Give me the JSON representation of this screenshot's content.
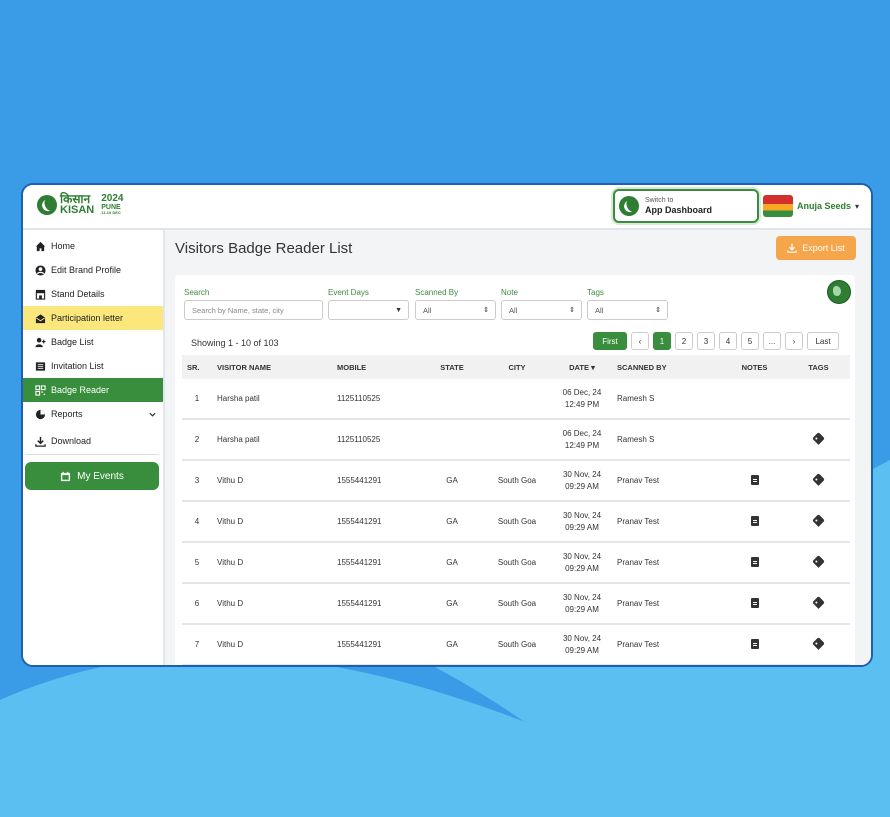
{
  "brand": {
    "logo_line1": "किसान",
    "logo_line2": "KISAN",
    "year": "2024",
    "city": "PUNE",
    "dates": "11-15 DEC"
  },
  "header": {
    "switch_small": "Switch to",
    "switch_main": "App Dashboard",
    "user_name": "Anuja Seeds",
    "user_caret": "▾"
  },
  "sidebar": {
    "items": [
      {
        "label": "Home",
        "icon": "home-icon"
      },
      {
        "label": "Edit Brand Profile",
        "icon": "user-circle-icon"
      },
      {
        "label": "Stand Details",
        "icon": "store-icon"
      },
      {
        "label": "Participation letter",
        "icon": "envelope-open-icon"
      },
      {
        "label": "Badge List",
        "icon": "user-plus-icon"
      },
      {
        "label": "Invitation List",
        "icon": "list-icon"
      },
      {
        "label": "Badge Reader",
        "icon": "qrcode-icon"
      },
      {
        "label": "Reports",
        "icon": "reports-icon"
      },
      {
        "label": "Download",
        "icon": "download-icon"
      }
    ],
    "my_events": "My Events"
  },
  "main": {
    "title": "Visitors Badge Reader List",
    "export_label": "Export List",
    "filters": {
      "search_label": "Search",
      "search_placeholder": "Search by Name, state, city",
      "event_days_label": "Event Days",
      "event_days_value": "",
      "scanned_by_label": "Scanned By",
      "scanned_by_value": "All",
      "note_label": "Note",
      "note_value": "All",
      "tags_label": "Tags",
      "tags_value": "All"
    },
    "showing": "Showing 1 - 10 of 103",
    "pager": {
      "first": "First",
      "prev": "‹",
      "pages": [
        "1",
        "2",
        "3",
        "4",
        "5"
      ],
      "ellipsis": "...",
      "next": "›",
      "last": "Last",
      "current": "1"
    },
    "columns": [
      "SR.",
      "VISITOR NAME",
      "MOBILE",
      "STATE",
      "CITY",
      "DATE ▾",
      "SCANNED BY",
      "NOTES",
      "TAGS"
    ],
    "rows": [
      {
        "sr": "1",
        "name": "Harsha patil",
        "mobile": "1125110525",
        "state": "",
        "city": "",
        "date": "06 Dec, 24",
        "time": "12:49 PM",
        "scanned_by": "Ramesh S",
        "notes": false,
        "tags": false
      },
      {
        "sr": "2",
        "name": "Harsha patil",
        "mobile": "1125110525",
        "state": "",
        "city": "",
        "date": "06 Dec, 24",
        "time": "12:49 PM",
        "scanned_by": "Ramesh S",
        "notes": false,
        "tags": true
      },
      {
        "sr": "3",
        "name": "Vithu D",
        "mobile": "1555441291",
        "state": "GA",
        "city": "South Goa",
        "date": "30 Nov, 24",
        "time": "09:29 AM",
        "scanned_by": "Pranav Test",
        "notes": true,
        "tags": true
      },
      {
        "sr": "4",
        "name": "Vithu D",
        "mobile": "1555441291",
        "state": "GA",
        "city": "South Goa",
        "date": "30 Nov, 24",
        "time": "09:29 AM",
        "scanned_by": "Pranav Test",
        "notes": true,
        "tags": true
      },
      {
        "sr": "5",
        "name": "Vithu D",
        "mobile": "1555441291",
        "state": "GA",
        "city": "South Goa",
        "date": "30 Nov, 24",
        "time": "09:29 AM",
        "scanned_by": "Pranav Test",
        "notes": true,
        "tags": true
      },
      {
        "sr": "6",
        "name": "Vithu D",
        "mobile": "1555441291",
        "state": "GA",
        "city": "South Goa",
        "date": "30 Nov, 24",
        "time": "09:29 AM",
        "scanned_by": "Pranav Test",
        "notes": true,
        "tags": true
      },
      {
        "sr": "7",
        "name": "Vithu D",
        "mobile": "1555441291",
        "state": "GA",
        "city": "South Goa",
        "date": "30 Nov, 24",
        "time": "09:29 AM",
        "scanned_by": "Pranav Test",
        "notes": true,
        "tags": true
      }
    ]
  },
  "colors": {
    "brand_green": "#388e3c",
    "highlight_yellow": "#fce77c",
    "export_orange": "#f5a54a",
    "page_blue": "#3a9be6"
  }
}
